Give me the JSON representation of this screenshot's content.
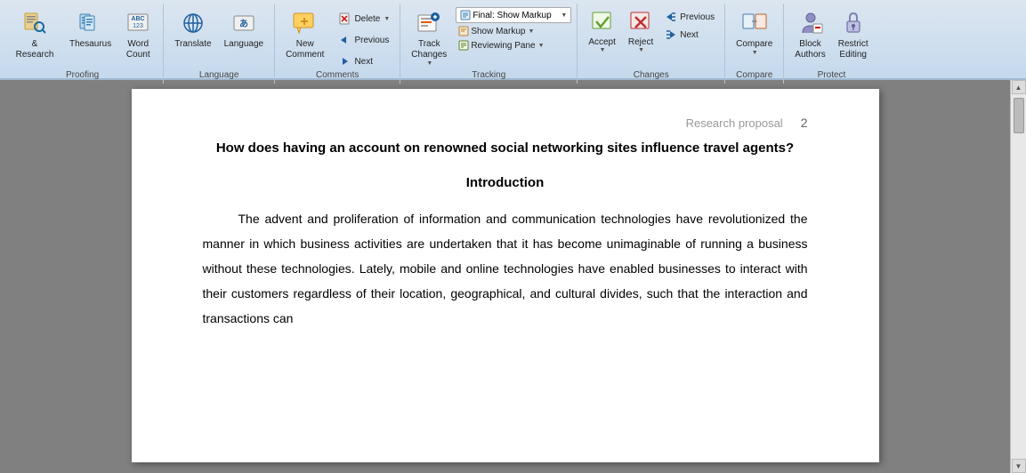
{
  "ribbon": {
    "groups": {
      "proofing": {
        "label": "Proofing",
        "buttons": [
          {
            "id": "research",
            "label": "& Research",
            "icon": "research"
          },
          {
            "id": "thesaurus",
            "label": "Thesaurus",
            "icon": "thesaurus"
          },
          {
            "id": "word-count",
            "label": "Word\nCount",
            "icon": "word-count"
          }
        ]
      },
      "language": {
        "label": "Language",
        "buttons": [
          {
            "id": "translate",
            "label": "Translate",
            "icon": "translate"
          },
          {
            "id": "language",
            "label": "Language",
            "icon": "language"
          }
        ]
      },
      "comments": {
        "label": "Comments",
        "buttons": [
          {
            "id": "new-comment",
            "label": "New\nComment",
            "icon": "new-comment"
          },
          {
            "id": "delete",
            "label": "Delete",
            "icon": "delete"
          },
          {
            "id": "previous",
            "label": "Previous",
            "icon": "previous"
          },
          {
            "id": "next",
            "label": "Next",
            "icon": "next"
          }
        ]
      },
      "tracking": {
        "label": "Tracking",
        "finalMarkup": "Final: Show Markup",
        "showMarkup": "Show Markup",
        "reviewingPane": "Reviewing Pane",
        "trackChanges": "Track\nChanges"
      },
      "changes": {
        "label": "Changes",
        "accept": "Accept",
        "reject": "Reject",
        "previous": "Previous",
        "next": "Next"
      },
      "compare": {
        "label": "Compare",
        "compare": "Compare"
      },
      "protect": {
        "label": "Protect",
        "blockAuthors": "Block\nAuthors",
        "restrictEditing": "Restrict\nEditing"
      }
    }
  },
  "document": {
    "pageLabel": "Research proposal",
    "pageNumber": "2",
    "title": "How does having an account on renowned social networking sites influence travel agents?",
    "sectionTitle": "Introduction",
    "paragraph": "The advent and proliferation of information and communication technologies have revolutionized the manner in which business activities are undertaken that it has become unimaginable of running a business without these technologies. Lately, mobile and online technologies have enabled businesses to interact with their customers regardless of their location, geographical, and cultural divides, such that the interaction and transactions can"
  }
}
